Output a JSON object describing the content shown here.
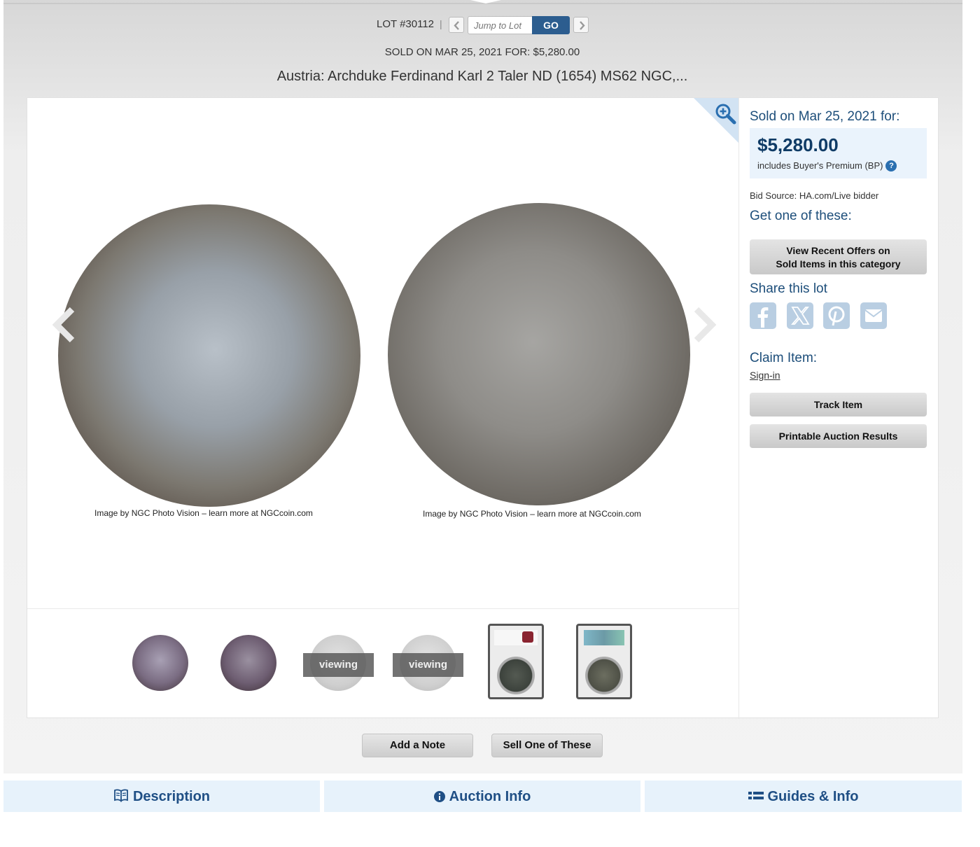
{
  "lotbar": {
    "lot_number": "LOT #30112",
    "separator": "|",
    "jump_placeholder": "Jump to Lot",
    "go_label": "GO"
  },
  "sold_line": "SOLD ON MAR 25, 2021 FOR: $5,280.00",
  "lot_title": "Austria: Archduke Ferdinand Karl 2 Taler ND (1654) MS62 NGC,...",
  "images": {
    "caption_obverse": "Image by NGC Photo Vision – learn more at NGCcoin.com",
    "caption_reverse": "Image by NGC Photo Vision – learn more at NGCcoin.com",
    "coin_colors": [
      "#98a0a8",
      "#8e8c88"
    ]
  },
  "thumbnails": {
    "viewing_label_1": "viewing",
    "viewing_label_2": "viewing",
    "items": [
      "coin-obverse",
      "coin-reverse",
      "coin-obverse-light",
      "coin-reverse-light",
      "slab-front",
      "slab-back"
    ]
  },
  "sidebar": {
    "sold_label": "Sold on Mar 25, 2021 for:",
    "price": "$5,280.00",
    "bp_note": "includes Buyer's Premium (BP)",
    "bp_help_icon": "?",
    "bid_source": "Bid Source: HA.com/Live bidder",
    "get_one": "Get one of these:",
    "offers_line1": "View Recent Offers on",
    "offers_line2": "Sold Items in this category",
    "share_label": "Share this lot",
    "share_icons": [
      "facebook-icon",
      "x-icon",
      "pinterest-icon",
      "email-icon"
    ],
    "claim_label": "Claim Item:",
    "signin_label": "Sign-in",
    "track_label": "Track Item",
    "printable_label": "Printable Auction Results"
  },
  "actions": {
    "add_note": "Add a Note",
    "sell_one": "Sell One of These"
  },
  "tabs": [
    {
      "label": "Description",
      "icon": "book-icon"
    },
    {
      "label": "Auction Info",
      "icon": "info-icon"
    },
    {
      "label": "Guides & Info",
      "icon": "list-icon"
    }
  ],
  "colors": {
    "accent": "#1d4e7a",
    "go_button": "#2c5d8f",
    "price_box": "#eaf3fc",
    "tab_bg": "#e7f2fb"
  }
}
